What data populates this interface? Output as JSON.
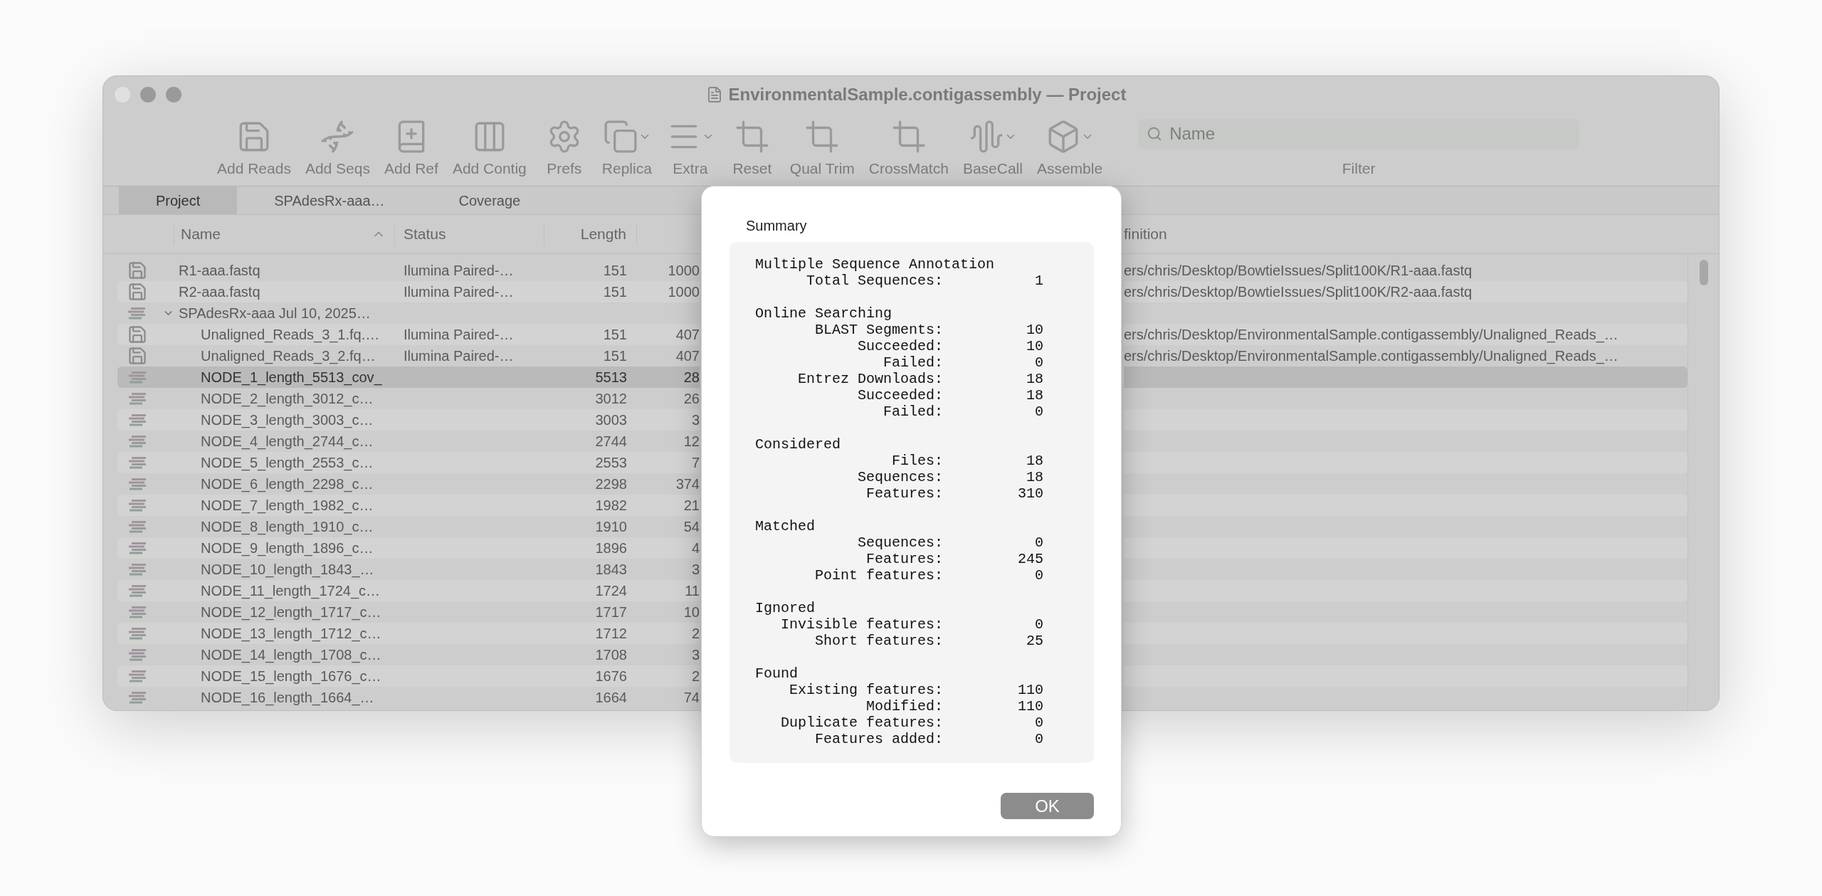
{
  "window": {
    "title": "EnvironmentalSample.contigassembly — Project"
  },
  "toolbar": [
    {
      "label": "Add Reads",
      "menu": false
    },
    {
      "label": "Add Seqs",
      "menu": false
    },
    {
      "label": "Add Ref",
      "menu": false
    },
    {
      "label": "Add Contig",
      "menu": false
    },
    {
      "label": "Prefs",
      "menu": false
    },
    {
      "label": "Replica",
      "menu": true
    },
    {
      "label": "Extra",
      "menu": true
    },
    {
      "label": "Reset",
      "menu": false
    },
    {
      "label": "Qual Trim",
      "menu": false
    },
    {
      "label": "CrossMatch",
      "menu": false
    },
    {
      "label": "BaseCall",
      "menu": true
    },
    {
      "label": "Assemble",
      "menu": true
    }
  ],
  "filter": {
    "placeholder": "Name",
    "label": "Filter"
  },
  "tabs": [
    {
      "label": "Project",
      "selected": true
    },
    {
      "label": "SPAdesRx-aaa…",
      "selected": false
    },
    {
      "label": "Coverage",
      "selected": false
    }
  ],
  "table": {
    "columns": [
      "Name",
      "Status",
      "Length",
      "finition"
    ],
    "rows": [
      {
        "kind": "reads",
        "name": "R1-aaa.fastq",
        "status": "Ilumina Paired-…",
        "length": "151",
        "column_4": "1000",
        "definition": "ers/chris/Desktop/BowtieIssues/Split100K/R1-aaa.fastq",
        "selected": false
      },
      {
        "kind": "reads",
        "name": "R2-aaa.fastq",
        "status": "Ilumina Paired-…",
        "length": "151",
        "column_4": "1000",
        "definition": "ers/chris/Desktop/BowtieIssues/Split100K/R2-aaa.fastq",
        "selected": false
      },
      {
        "kind": "contig",
        "name": "SPAdesRx-aaa Jul 10, 2025…",
        "expanded": true,
        "selected": false,
        "children": [
          {
            "kind": "reads",
            "name": "Unaligned_Reads_3_1.fq.…",
            "status": "Ilumina Paired-…",
            "length": "151",
            "column_4": "407",
            "definition": "ers/chris/Desktop/EnvironmentalSample.contigassembly/Unaligned_Reads_…",
            "selected": false
          },
          {
            "kind": "reads",
            "name": "Unaligned_Reads_3_2.fq…",
            "status": "Ilumina Paired-…",
            "length": "151",
            "column_4": "407",
            "definition": "ers/chris/Desktop/EnvironmentalSample.contigassembly/Unaligned_Reads_…",
            "selected": false
          },
          {
            "kind": "contig",
            "name": "NODE_1_length_5513_cov_",
            "length": "5513",
            "column_4": "28",
            "selected": true
          },
          {
            "kind": "contig",
            "name": "NODE_2_length_3012_c…",
            "length": "3012",
            "column_4": "26",
            "selected": false
          },
          {
            "kind": "contig",
            "name": "NODE_3_length_3003_c…",
            "length": "3003",
            "column_4": "3",
            "selected": false
          },
          {
            "kind": "contig",
            "name": "NODE_4_length_2744_c…",
            "length": "2744",
            "column_4": "12",
            "selected": false
          },
          {
            "kind": "contig",
            "name": "NODE_5_length_2553_c…",
            "length": "2553",
            "column_4": "7",
            "selected": false
          },
          {
            "kind": "contig",
            "name": "NODE_6_length_2298_c…",
            "length": "2298",
            "column_4": "374",
            "selected": false
          },
          {
            "kind": "contig",
            "name": "NODE_7_length_1982_c…",
            "length": "1982",
            "column_4": "21",
            "selected": false
          },
          {
            "kind": "contig",
            "name": "NODE_8_length_1910_c…",
            "length": "1910",
            "column_4": "54",
            "selected": false
          },
          {
            "kind": "contig",
            "name": "NODE_9_length_1896_c…",
            "length": "1896",
            "column_4": "4",
            "selected": false
          },
          {
            "kind": "contig",
            "name": "NODE_10_length_1843_…",
            "length": "1843",
            "column_4": "3",
            "selected": false
          },
          {
            "kind": "contig",
            "name": "NODE_11_length_1724_c…",
            "length": "1724",
            "column_4": "11",
            "selected": false
          },
          {
            "kind": "contig",
            "name": "NODE_12_length_1717_c…",
            "length": "1717",
            "column_4": "10",
            "selected": false
          },
          {
            "kind": "contig",
            "name": "NODE_13_length_1712_c…",
            "length": "1712",
            "column_4": "2",
            "selected": false
          },
          {
            "kind": "contig",
            "name": "NODE_14_length_1708_c…",
            "length": "1708",
            "column_4": "3",
            "selected": false
          },
          {
            "kind": "contig",
            "name": "NODE_15_length_1676_c…",
            "length": "1676",
            "column_4": "2",
            "selected": false
          },
          {
            "kind": "contig",
            "name": "NODE_16_length_1664_…",
            "length": "1664",
            "column_4": "74",
            "selected": false
          }
        ]
      }
    ]
  },
  "dialog": {
    "title": "Summary",
    "sections": [
      {
        "heading": "Multiple Sequence Annotation",
        "items": [
          {
            "label": "Total Sequences:",
            "value": "1"
          }
        ]
      },
      {
        "heading": "Online Searching",
        "items": [
          {
            "label": "BLAST Segments:",
            "value": "10"
          },
          {
            "label": "Succeeded:",
            "value": "10"
          },
          {
            "label": "Failed:",
            "value": "0"
          },
          {
            "label": "Entrez Downloads:",
            "value": "18"
          },
          {
            "label": "Succeeded:",
            "value": "18"
          },
          {
            "label": "Failed:",
            "value": "0"
          }
        ]
      },
      {
        "heading": "Considered",
        "items": [
          {
            "label": "Files:",
            "value": "18"
          },
          {
            "label": "Sequences:",
            "value": "18"
          },
          {
            "label": "Features:",
            "value": "310"
          }
        ]
      },
      {
        "heading": "Matched",
        "items": [
          {
            "label": "Sequences:",
            "value": "0"
          },
          {
            "label": "Features:",
            "value": "245"
          },
          {
            "label": "Point features:",
            "value": "0"
          }
        ]
      },
      {
        "heading": "Ignored",
        "items": [
          {
            "label": "Invisible features:",
            "value": "0"
          },
          {
            "label": "Short features:",
            "value": "25"
          }
        ]
      },
      {
        "heading": "Found",
        "items": [
          {
            "label": "Existing features:",
            "value": "110"
          },
          {
            "label": "Modified:",
            "value": "110"
          },
          {
            "label": "Duplicate features:",
            "value": "0"
          },
          {
            "label": "Features added:",
            "value": "0"
          }
        ]
      }
    ],
    "buttons": [
      "OK"
    ]
  }
}
